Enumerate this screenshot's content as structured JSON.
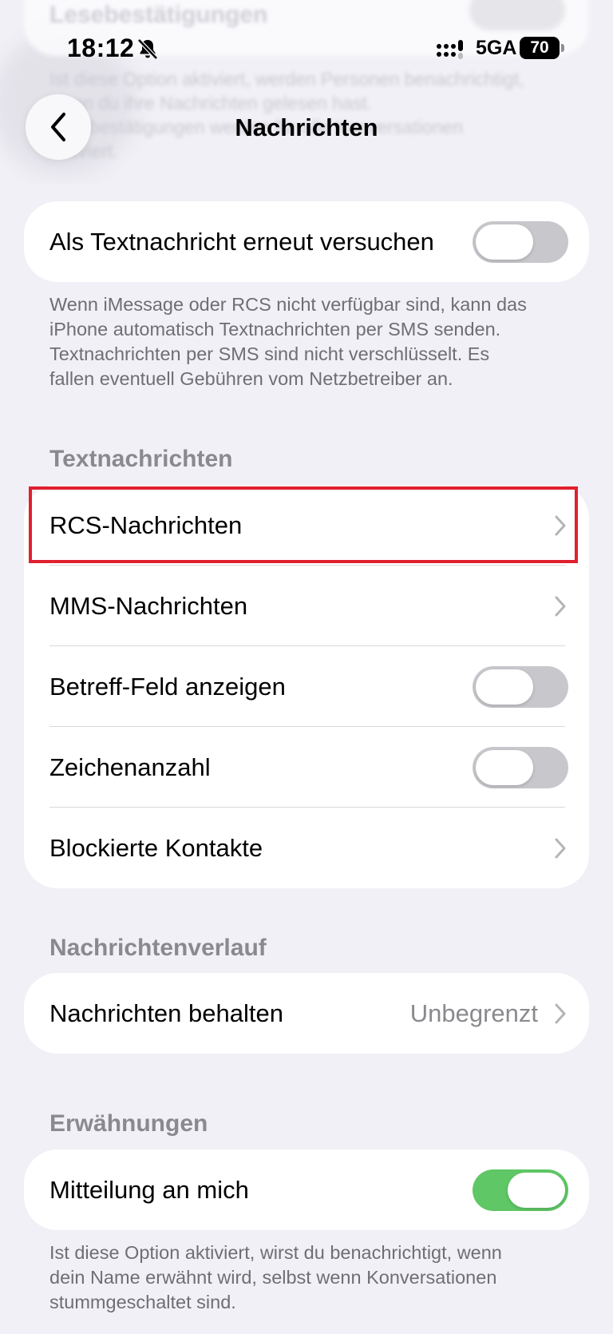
{
  "status_bar": {
    "time": "18:12",
    "network": "5GA",
    "battery": "70"
  },
  "background_ghost": {
    "title": "Lesebestätigungen",
    "text": "Ist diese Option aktiviert, werden Personen benachrichtigt, wenn du ihre Nachrichten gelesen hast. Lesebestätigungen werden für alle Konversationen aktiviert."
  },
  "nav": {
    "title": "Nachrichten",
    "back_icon": "chevron-left-icon"
  },
  "sms_fallback": {
    "label": "Als Textnachricht erneut versuchen",
    "enabled": false,
    "footnote": "Wenn iMessage oder RCS nicht verfügbar sind, kann das iPhone automatisch Textnachrichten per SMS senden. Textnachrichten per SMS sind nicht verschlüsselt. Es fallen eventuell Gebühren vom Netzbetreiber an."
  },
  "textnachrichten": {
    "header": "Textnachrichten",
    "rows": [
      {
        "label": "RCS-Nachrichten",
        "kind": "link"
      },
      {
        "label": "MMS-Nachrichten",
        "kind": "link"
      },
      {
        "label": "Betreff-Feld anzeigen",
        "kind": "toggle",
        "enabled": false
      },
      {
        "label": "Zeichenanzahl",
        "kind": "toggle",
        "enabled": false
      },
      {
        "label": "Blockierte Kontakte",
        "kind": "link"
      }
    ]
  },
  "verlauf": {
    "header": "Nachrichtenverlauf",
    "row": {
      "label": "Nachrichten behalten",
      "value": "Unbegrenzt"
    }
  },
  "erwaehnungen": {
    "header": "Erwähnungen",
    "row": {
      "label": "Mitteilung an mich",
      "enabled": true
    },
    "footnote": "Ist diese Option aktiviert, wirst du benachrichtigt, wenn dein Name erwähnt wird, selbst wenn Konversationen stummgeschaltet sind."
  },
  "colors": {
    "background": "#f1f0f6",
    "toggle_on": "#5fc765",
    "toggle_off": "#c7c7cc",
    "highlight": "#e0202e"
  }
}
